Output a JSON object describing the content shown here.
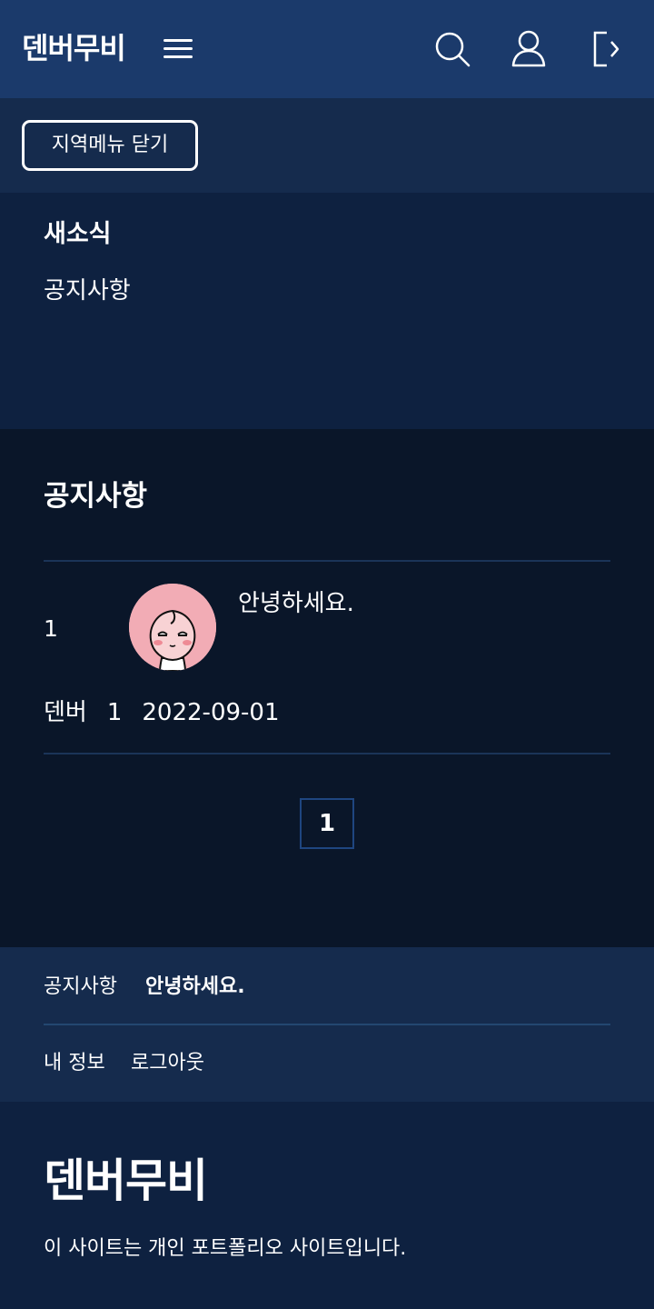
{
  "header": {
    "logo": "덴버무비",
    "icons": [
      "menu-icon",
      "search-icon",
      "user-icon",
      "logout-icon"
    ]
  },
  "submenu": {
    "close_label": "지역메뉴 닫기"
  },
  "local_menu": {
    "title": "새소식",
    "items": [
      {
        "label": "공지사항"
      }
    ]
  },
  "board": {
    "title": "공지사항",
    "posts": [
      {
        "number": "1",
        "title": "안녕하세요.",
        "author": "덴버",
        "views": "1",
        "date": "2022-09-01"
      }
    ],
    "pagination": {
      "current": "1"
    }
  },
  "footer_nav": {
    "crumb": "공지사항",
    "current": "안녕하세요.",
    "links": [
      "내 정보",
      "로그아웃"
    ]
  },
  "site_footer": {
    "logo": "덴버무비",
    "description": "이 사이트는 개인 포트폴리오 사이트입니다."
  },
  "colors": {
    "header_bg": "#1b3a6b",
    "submenu_bg": "#152b4d",
    "local_menu_bg": "#0e2140",
    "board_bg": "#0a1629",
    "avatar_bg": "#f2acb5"
  }
}
